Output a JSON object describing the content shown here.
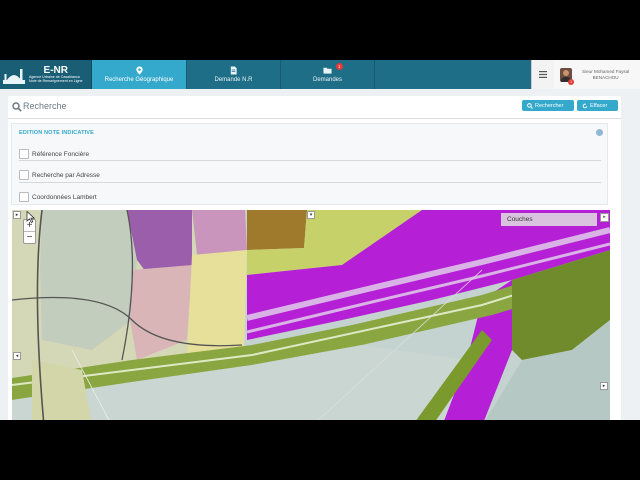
{
  "app": {
    "logo_title": "E-NR",
    "logo_sub1": "Agence Urbaine de Casablanca",
    "logo_sub2": "Note de Renseignement en Ligne"
  },
  "nav": {
    "tabs": [
      {
        "label": "Recherche Géographique",
        "icon": "map-marker-icon",
        "active": true
      },
      {
        "label": "Demande N.R",
        "icon": "document-icon",
        "active": false
      },
      {
        "label": "Demandes",
        "icon": "folder-icon",
        "active": false,
        "badge": "1"
      }
    ],
    "user_name_line1": "Sieur Mohamed Faysal",
    "user_name_line2": "BENACHOU",
    "user_badge": "1"
  },
  "search": {
    "title": "Recherche",
    "rechercher_label": "Rechercher",
    "effacer_label": "Effacer"
  },
  "edition": {
    "title": "EDITION NOTE INDICATIVE",
    "options": [
      {
        "label": "Référence Foncière",
        "checked": false
      },
      {
        "label": "Recherche par Adresse",
        "checked": false
      },
      {
        "label": "Coordonnées Lambert",
        "checked": false
      }
    ]
  },
  "map": {
    "layers_label": "Couches",
    "zoom_in": "+",
    "zoom_out": "−",
    "layer_colors": {
      "industrial": "#b51fd6",
      "residential": "#e6e09a",
      "green": "#7f9a2e",
      "urban": "#cbd2c4",
      "historic": "#a07a2c",
      "water_blue": "#c7d8d6"
    }
  },
  "colors": {
    "navbar": "#1f6e87",
    "active_tab": "#35a9cc",
    "accent": "#35a9cc",
    "badge": "#e53935"
  }
}
